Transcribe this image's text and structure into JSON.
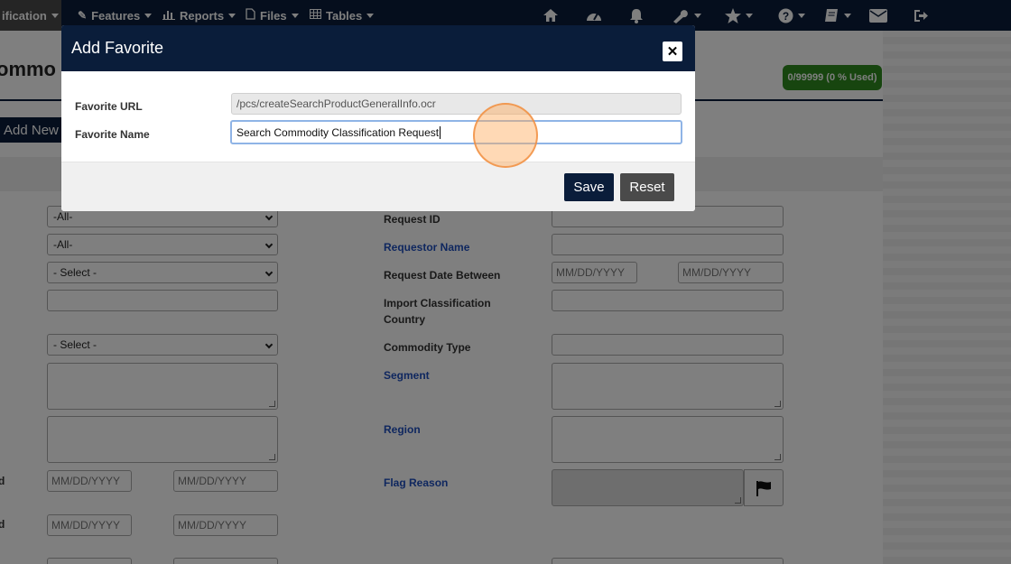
{
  "nav": {
    "items": [
      {
        "label": "ification"
      },
      {
        "label": "Features",
        "icon": "pencil-icon"
      },
      {
        "label": "Reports",
        "icon": "bar-chart-icon"
      },
      {
        "label": "Files",
        "icon": "file-icon"
      },
      {
        "label": "Tables",
        "icon": "table-icon"
      }
    ],
    "icons": [
      "home-icon",
      "dashboard-icon",
      "bell-icon",
      "wrench-icon",
      "star-icon",
      "help-icon",
      "book-icon",
      "mail-icon",
      "logout-icon"
    ],
    "bg_color": "#0a1d3a"
  },
  "page": {
    "title": "ommo",
    "quota": "0/99999 (0 % Used)",
    "add_new": "Add New",
    "left_fields": {
      "select_1": "-All-",
      "select_2": "-All-",
      "select_3": "- Select -",
      "select_4": "- Select -",
      "date_placeholder": "MM/DD/YYYY",
      "edge_label_1": "d",
      "edge_label_2": "d"
    },
    "right_labels": {
      "request_id": "Request ID",
      "requestor_name": "Requestor Name",
      "request_date": "Request Date Between",
      "import_country": "Import Classification Country",
      "commodity_type": "Commodity Type",
      "segment": "Segment",
      "region": "Region",
      "flag_reason": "Flag Reason"
    },
    "date_placeholder": "MM/DD/YYYY"
  },
  "modal": {
    "title": "Add Favorite",
    "url_label": "Favorite URL",
    "url_value": "/pcs/createSearchProductGeneralInfo.ocr",
    "name_label": "Favorite Name",
    "name_value": "Search Commodity Classification Request",
    "save_label": "Save",
    "reset_label": "Reset",
    "close_symbol": "✕"
  }
}
